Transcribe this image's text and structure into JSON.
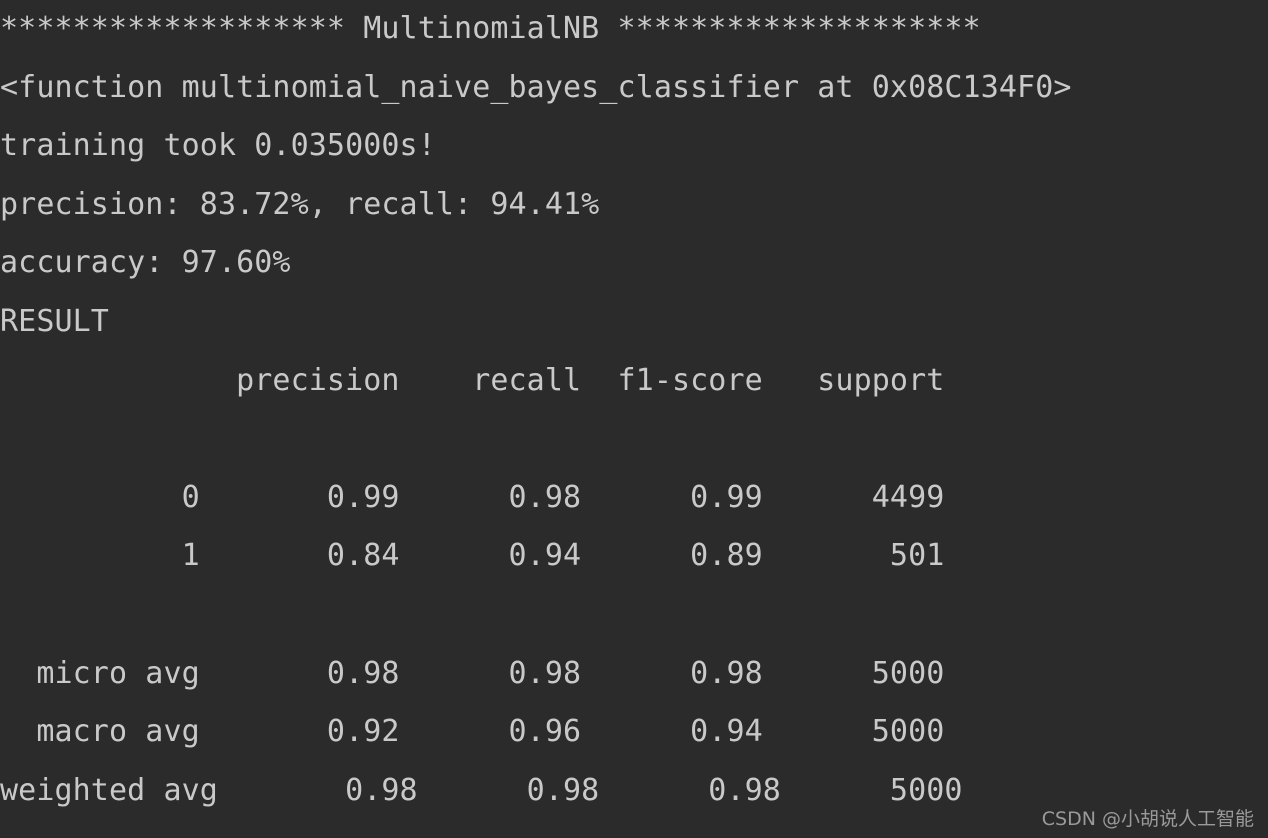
{
  "terminal": {
    "background_color": "#2b2b2b",
    "text_color": "#c9c9c9",
    "lines": [
      {
        "id": "banner",
        "text": "******************* MultinomialNB ********************"
      },
      {
        "id": "function-repr",
        "text": "<function multinomial_naive_bayes_classifier at 0x08C134F0>"
      },
      {
        "id": "training-time",
        "text": "training took 0.035000s!"
      },
      {
        "id": "precision-recall",
        "text": "precision: 83.72%, recall: 94.41%"
      },
      {
        "id": "accuracy",
        "text": "accuracy: 97.60%"
      },
      {
        "id": "result-label",
        "text": "RESULT"
      },
      {
        "id": "report-header",
        "text": "             precision    recall  f1-score   support"
      },
      {
        "id": "spacer-1",
        "text": " "
      },
      {
        "id": "row-class-0",
        "text": "          0       0.99      0.98      0.99      4499"
      },
      {
        "id": "row-class-1",
        "text": "          1       0.84      0.94      0.89       501"
      },
      {
        "id": "spacer-2",
        "text": " "
      },
      {
        "id": "row-micro-avg",
        "text": "  micro avg       0.98      0.98      0.98      5000"
      },
      {
        "id": "row-macro-avg",
        "text": "  macro avg       0.92      0.96      0.94      5000"
      },
      {
        "id": "row-weighted-avg",
        "text": "weighted avg       0.98      0.98      0.98      5000"
      }
    ]
  },
  "banner": {
    "left_stars": "*******************",
    "model_name": "MultinomialNB",
    "right_stars": "********************"
  },
  "run_info": {
    "function_repr": "<function multinomial_naive_bayes_classifier at 0x08C134F0>",
    "function_name": "multinomial_naive_bayes_classifier",
    "memory_address": "0x08C134F0",
    "training_time_label": "training took",
    "training_time_value": "0.035000s!",
    "precision_label": "precision:",
    "precision_value": "83.72%",
    "recall_label": "recall:",
    "recall_value": "94.41%",
    "accuracy_label": "accuracy:",
    "accuracy_value": "97.60%",
    "result_label": "RESULT"
  },
  "classification_report": {
    "columns": [
      "",
      "precision",
      "recall",
      "f1-score",
      "support"
    ],
    "rows": [
      {
        "label": "0",
        "precision": "0.99",
        "recall": "0.98",
        "f1_score": "0.99",
        "support": "4499"
      },
      {
        "label": "1",
        "precision": "0.84",
        "recall": "0.94",
        "f1_score": "0.89",
        "support": "501"
      },
      {
        "label": "micro avg",
        "precision": "0.98",
        "recall": "0.98",
        "f1_score": "0.98",
        "support": "5000"
      },
      {
        "label": "macro avg",
        "precision": "0.92",
        "recall": "0.96",
        "f1_score": "0.94",
        "support": "5000"
      },
      {
        "label": "weighted avg",
        "precision": "0.98",
        "recall": "0.98",
        "f1_score": "0.98",
        "support": "5000"
      }
    ]
  },
  "watermark": {
    "text": "CSDN @小胡说人工智能"
  }
}
